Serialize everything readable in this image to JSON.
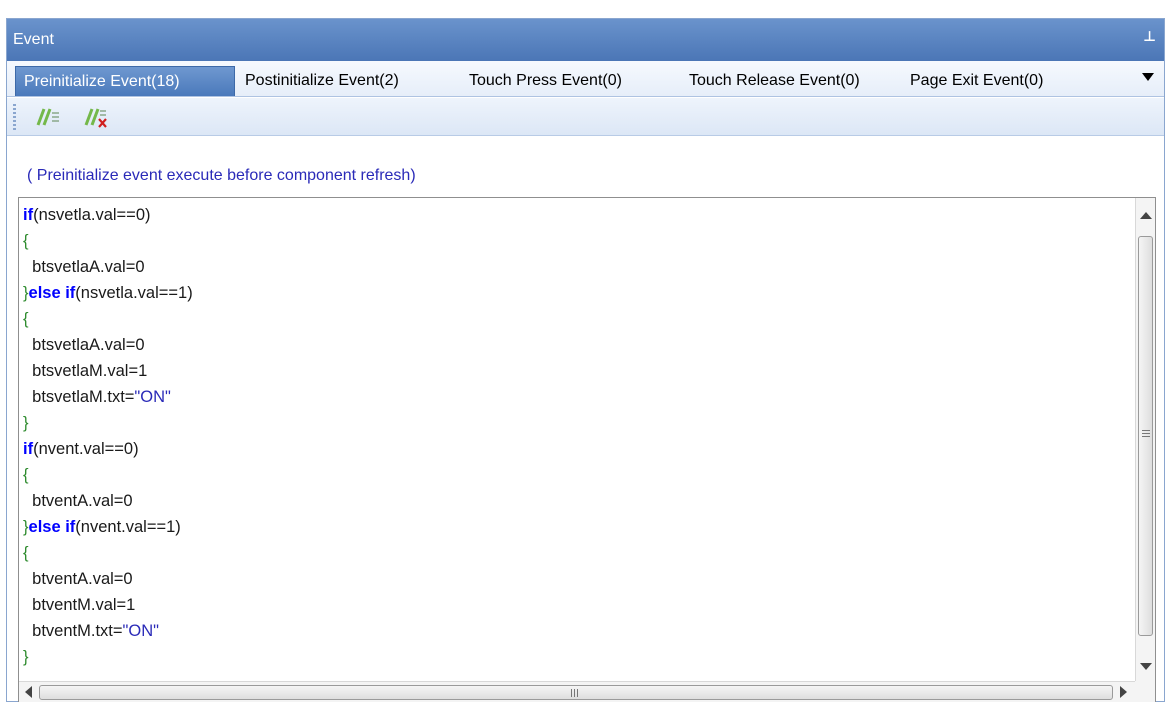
{
  "panel": {
    "title": "Event",
    "pin_icon": "pin-icon"
  },
  "tabs": [
    {
      "label": "Preinitialize Event(18)",
      "active": true
    },
    {
      "label": "Postinitialize Event(2)",
      "active": false
    },
    {
      "label": "Touch Press Event(0)",
      "active": false
    },
    {
      "label": "Touch Release Event(0)",
      "active": false
    },
    {
      "label": "Page Exit Event(0)",
      "active": false
    }
  ],
  "toolbar": {
    "buttons": [
      {
        "icon": "comment-lines-icon"
      },
      {
        "icon": "uncomment-lines-icon"
      }
    ]
  },
  "hint": "( Preinitialize event execute before component refresh)",
  "code_lines": [
    "if(nsvetla.val==0)",
    "{",
    "  btsvetlaA.val=0",
    "}else if(nsvetla.val==1)",
    "{",
    "  btsvetlaA.val=0",
    "  btsvetlaM.val=1",
    "  btsvetlaM.txt=\"ON\"",
    "}",
    "if(nvent.val==0)",
    "{",
    "  btventA.val=0",
    "}else if(nvent.val==1)",
    "{",
    "  btventA.val=0",
    "  btventM.val=1",
    "  btventM.txt=\"ON\"",
    "}"
  ],
  "colors": {
    "title_bar": "#4b76b6",
    "keyword": "#0000ff",
    "brace": "#2e8b2e",
    "string": "#2a2ab8",
    "hint_text": "#2a2ab8"
  }
}
